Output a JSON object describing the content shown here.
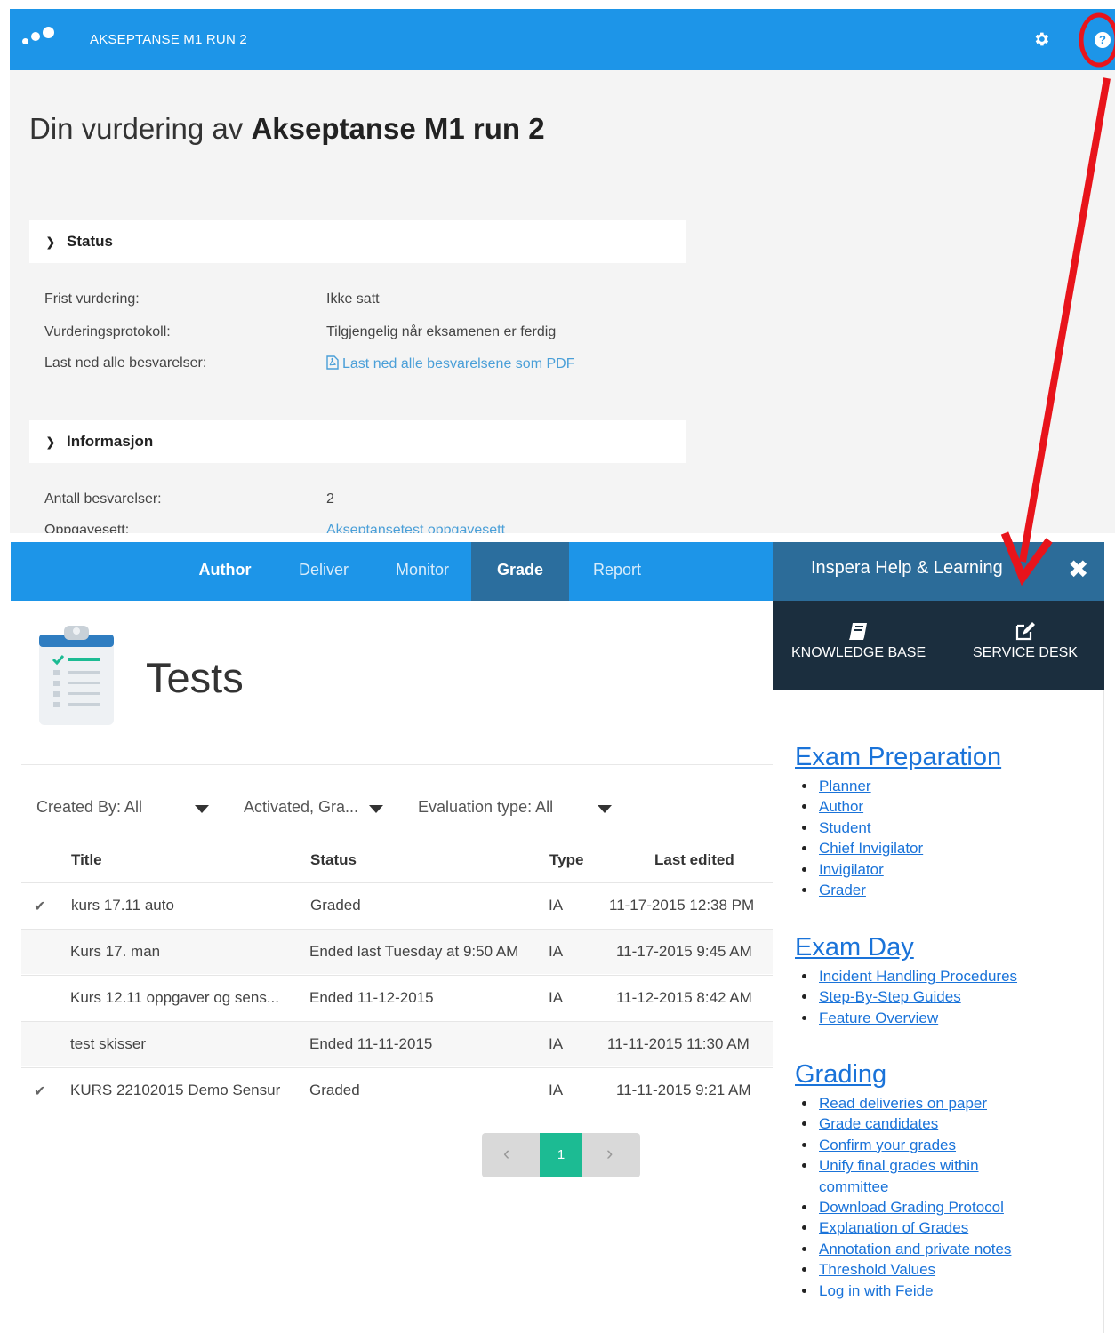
{
  "top": {
    "app_name": "AKSEPTANSE M1 RUN 2",
    "title_prefix": "Din vurdering av",
    "title_bold": "Akseptanse M1 run 2",
    "help_glyph": "?",
    "status_panel": {
      "heading": "Status",
      "rows": [
        {
          "label": "Frist vurdering:",
          "value": "Ikke satt"
        },
        {
          "label": "Vurderingsprotokoll:",
          "value": "Tilgjengelig når eksamenen er ferdig"
        },
        {
          "label": "Last ned alle besvarelser:",
          "value": "Last ned alle besvarelsene som PDF"
        }
      ]
    },
    "info_panel": {
      "heading": "Informasjon",
      "rows": [
        {
          "label": "Antall besvarelser:",
          "value": "2"
        },
        {
          "label": "Oppgavesett:",
          "value": "Akseptansetest oppgavesett"
        }
      ]
    },
    "colors": {
      "bar": "#1d95e8",
      "annotation": "#e8141b"
    }
  },
  "nav": {
    "items": [
      "Author",
      "Deliver",
      "Monitor",
      "Grade",
      "Report"
    ],
    "active": "Grade"
  },
  "tests": {
    "title": "Tests",
    "filters": {
      "created_by": "Created By: All",
      "status": "Activated, Gra...",
      "evaluation": "Evaluation type: All"
    },
    "columns": [
      "Title",
      "Status",
      "Type",
      "Last edited"
    ],
    "rows": [
      {
        "checked": true,
        "title": "kurs 17.11 auto",
        "status": "Graded",
        "type": "IA",
        "edited": "11-17-2015 12:38 PM"
      },
      {
        "checked": false,
        "title": "Kurs 17. man",
        "status": "Ended last Tuesday at 9:50 AM",
        "type": "IA",
        "edited": "11-17-2015 9:45 AM"
      },
      {
        "checked": false,
        "title": "Kurs 12.11 oppgaver og sens...",
        "status": "Ended 11-12-2015",
        "type": "IA",
        "edited": "11-12-2015 8:42 AM"
      },
      {
        "checked": false,
        "title": "test skisser",
        "status": "Ended 11-11-2015",
        "type": "IA",
        "edited": "11-11-2015 11:30 AM"
      },
      {
        "checked": true,
        "title": "KURS 22102015 Demo Sensur",
        "status": "Graded",
        "type": "IA",
        "edited": "11-11-2015 9:21 AM"
      }
    ],
    "pager": {
      "prev": "‹",
      "current": "1",
      "next": "›"
    }
  },
  "help": {
    "title": "Inspera Help & Learning",
    "close": "✖",
    "tools": {
      "knowledge": "KNOWLEDGE BASE",
      "service": "SERVICE DESK"
    },
    "sections": [
      {
        "title": "Exam Preparation",
        "links": [
          "Planner",
          "Author",
          "Student",
          "Chief Invigilator",
          "Invigilator",
          "Grader"
        ]
      },
      {
        "title": "Exam Day",
        "links": [
          "Incident Handling Procedures",
          "Step-By-Step Guides",
          "Feature Overview"
        ]
      },
      {
        "title": "Grading",
        "links": [
          "Read deliveries on paper",
          "Grade candidates",
          "Confirm your grades",
          "Unify final grades within committee",
          "Download Grading Protocol",
          "Explanation of Grades",
          "Annotation and private notes",
          "Threshold Values",
          "Log in with Feide"
        ]
      }
    ]
  }
}
